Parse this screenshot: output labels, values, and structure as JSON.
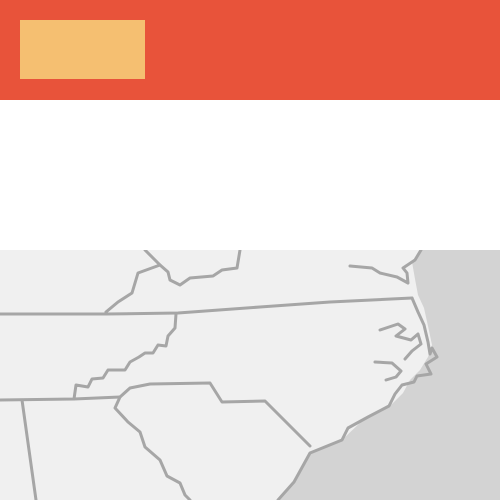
{
  "header": {
    "background_color": "#e8533a",
    "block_color": "#f5bf71"
  },
  "map": {
    "land_color": "#f0f0f0",
    "water_color": "#d3d3d3",
    "border_color": "#a6a6a6"
  }
}
